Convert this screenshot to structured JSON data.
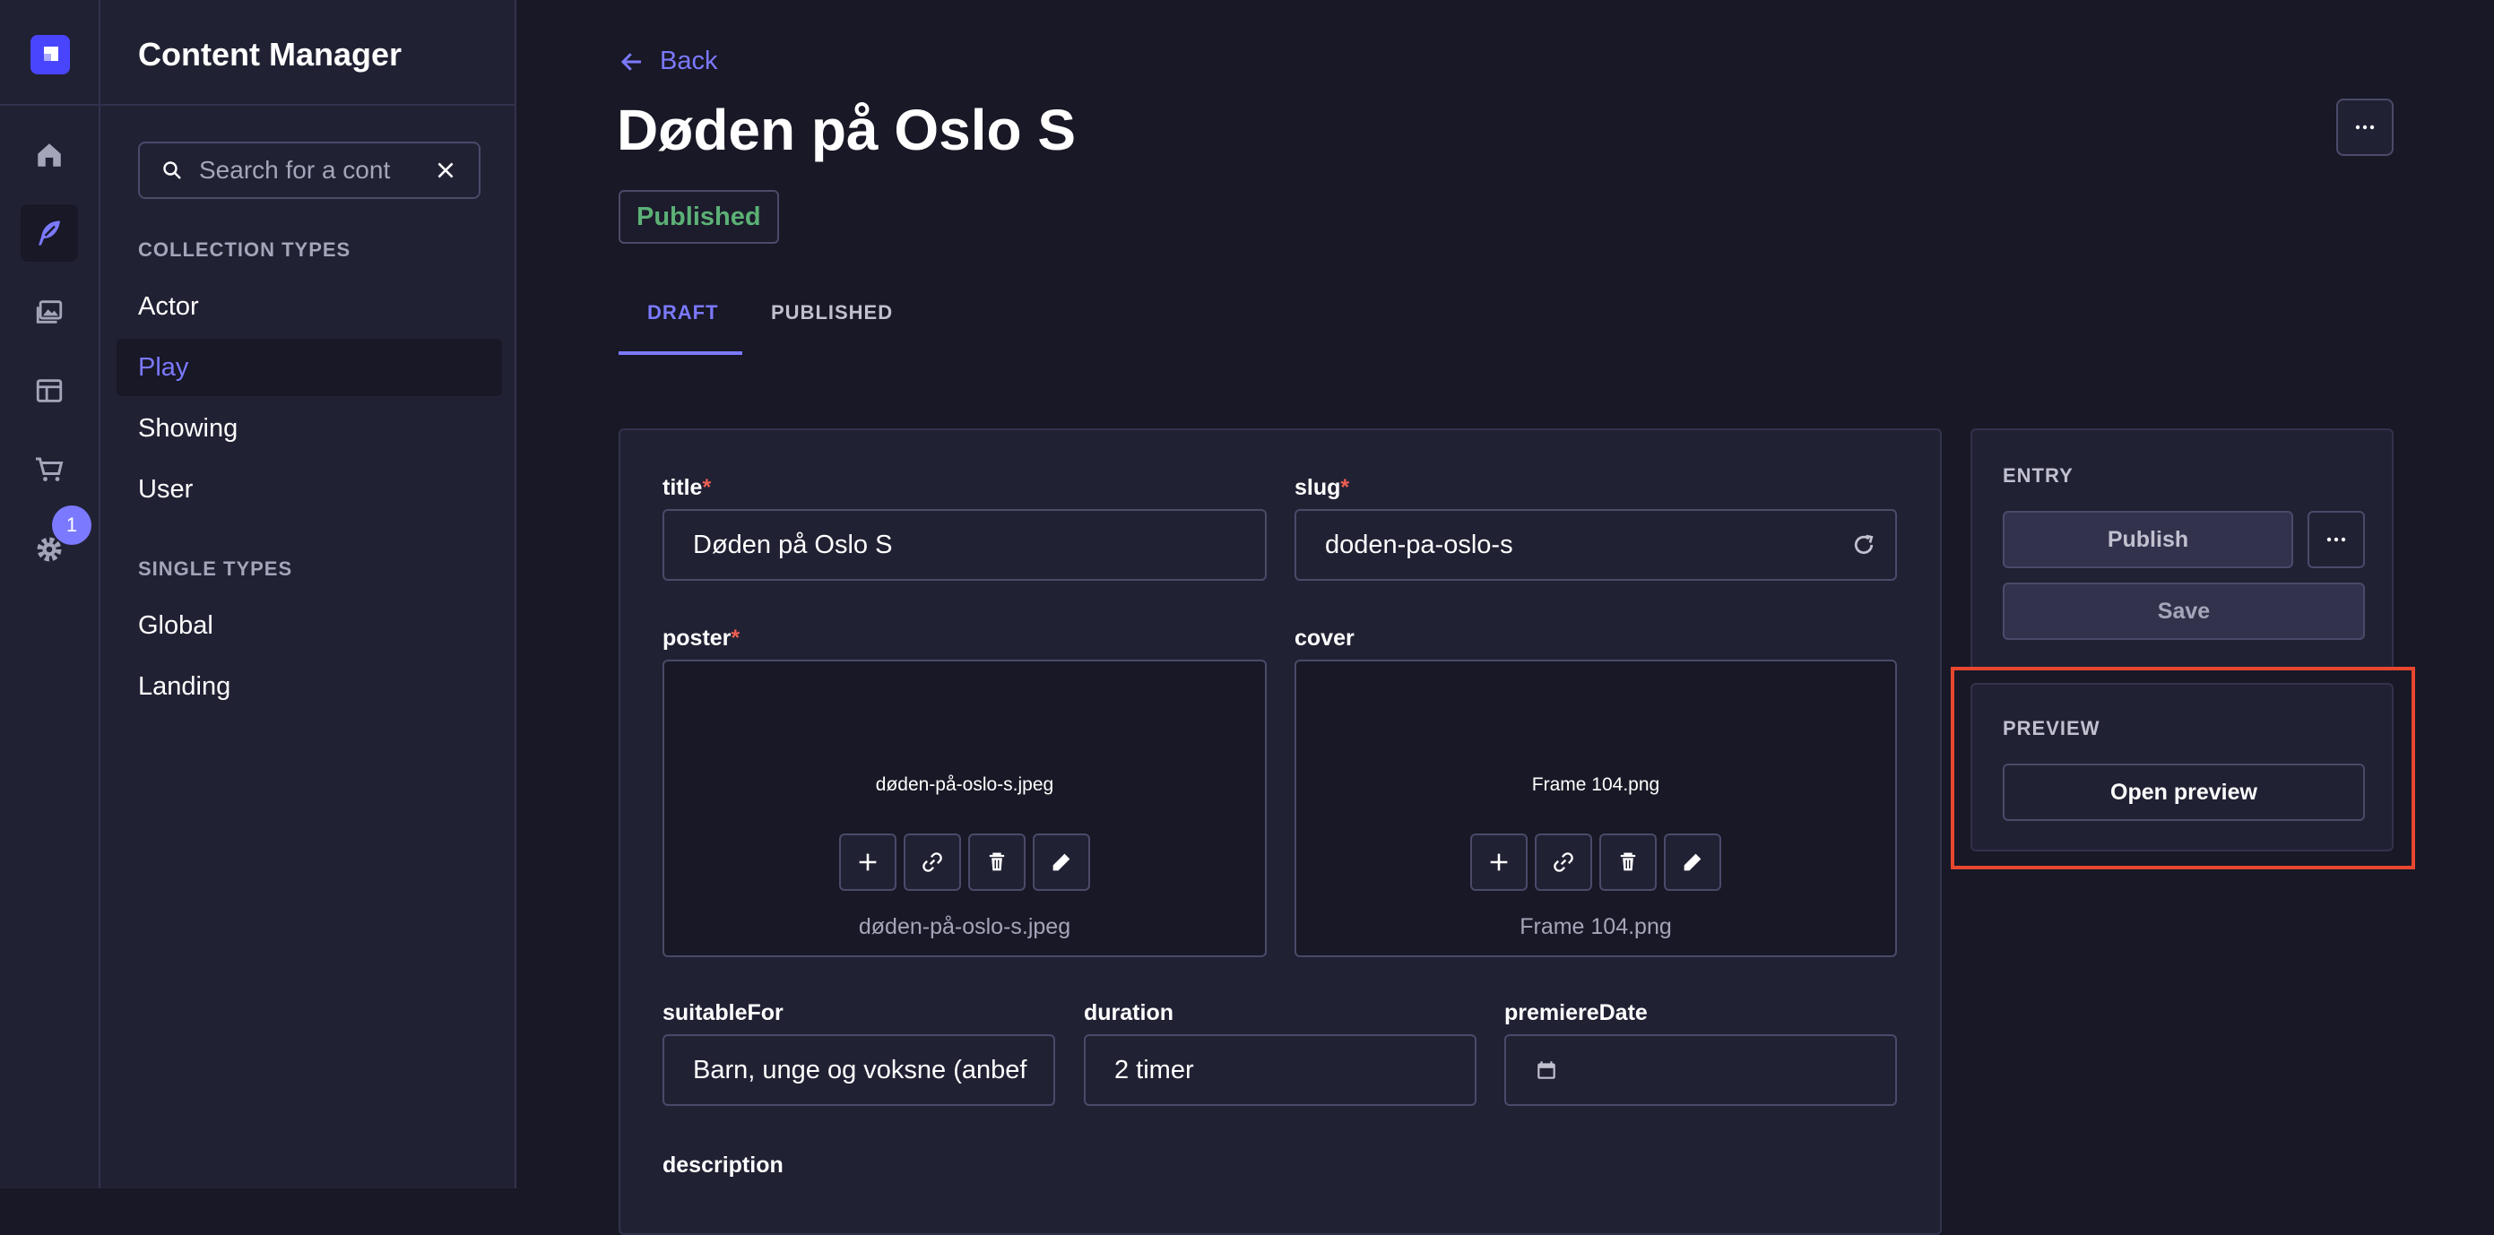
{
  "app": {
    "section_title": "Content Manager"
  },
  "rail": {
    "notification_count": "1"
  },
  "sidebar": {
    "search_placeholder": "Search for a cont",
    "collection_types_label": "COLLECTION TYPES",
    "collection_types": [
      "Actor",
      "Play",
      "Showing",
      "User"
    ],
    "active_item": "Play",
    "single_types_label": "SINGLE TYPES",
    "single_types": [
      "Global",
      "Landing"
    ]
  },
  "header": {
    "back_label": "Back",
    "title": "Døden på Oslo S",
    "status_badge": "Published",
    "tabs": [
      "DRAFT",
      "PUBLISHED"
    ],
    "active_tab": "DRAFT"
  },
  "form": {
    "title_label": "title",
    "title_value": "Døden på Oslo S",
    "slug_label": "slug",
    "slug_value": "doden-pa-oslo-s",
    "poster_label": "poster",
    "poster_file": "døden-på-oslo-s.jpeg",
    "cover_label": "cover",
    "cover_file": "Frame 104.png",
    "suitable_label": "suitableFor",
    "suitable_value": "Barn, unge og voksne (anbef",
    "duration_label": "duration",
    "duration_value": "2 timer",
    "premiere_label": "premiereDate",
    "premiere_value": "",
    "description_label": "description",
    "required_marker": "*"
  },
  "entry_panel": {
    "label": "ENTRY",
    "publish_label": "Publish",
    "save_label": "Save"
  },
  "preview_panel": {
    "label": "PREVIEW",
    "open_preview_label": "Open preview"
  },
  "colors": {
    "accent": "#7b79ff",
    "brand": "#4945ff",
    "published_green": "#5cb176",
    "required_red": "#ee5e52",
    "highlight_red": "#e8472f"
  }
}
